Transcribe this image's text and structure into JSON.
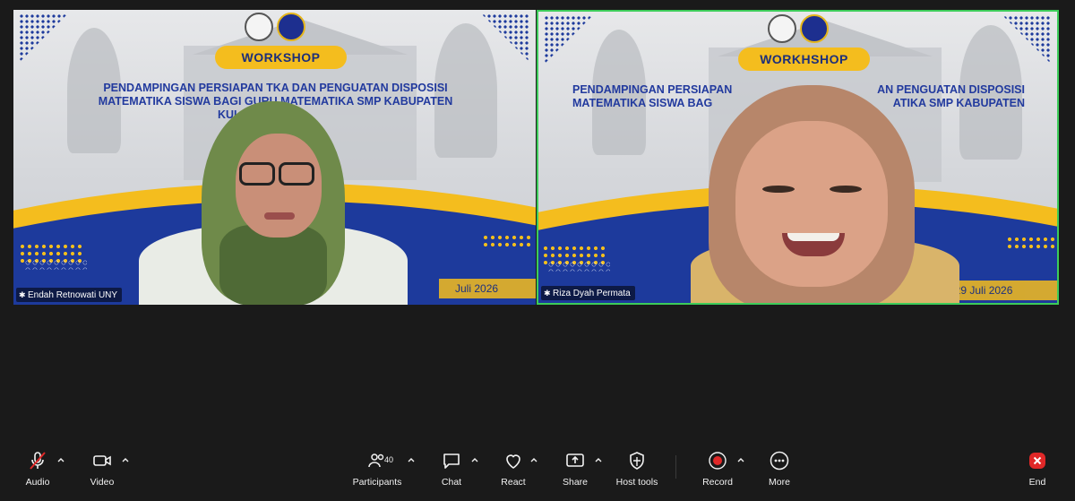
{
  "tiles": [
    {
      "participant_name": "Endah Retnowati UNY",
      "banner": {
        "badge": "WORKSHOP",
        "headline_line1": "PENDAMPINGAN PERSIAPAN TKA DAN PENGUATAN DISPOSISI",
        "headline_line2": "MATEMATIKA SISWA BAGI GURU MATEMATIKA SMP KABUPATEN",
        "headline_line3": "KULO",
        "date_text": "Juli 2026"
      },
      "active_speaker": false
    },
    {
      "participant_name": "Riza Dyah Permata",
      "banner": {
        "badge": "WORKHSHOP",
        "headline_line1": "PENDAMPINGAN PERSIAPAN",
        "headline_line1b": "AN PENGUATAN DISPOSISI",
        "headline_line2": "MATEMATIKA SISWA BAG",
        "headline_line2b": "ATIKA SMP KABUPATEN",
        "date_text": ": 29 Juli 2026"
      },
      "active_speaker": true
    }
  ],
  "toolbar": {
    "audio": {
      "label": "Audio",
      "icon": "mic-muted-icon",
      "muted_color": "#e02828"
    },
    "video": {
      "label": "Video",
      "icon": "video-camera-icon"
    },
    "participants": {
      "label": "Participants",
      "icon": "participants-icon",
      "count": "40"
    },
    "chat": {
      "label": "Chat",
      "icon": "chat-bubble-icon"
    },
    "react": {
      "label": "React",
      "icon": "heart-icon"
    },
    "share": {
      "label": "Share",
      "icon": "share-screen-icon"
    },
    "host_tools": {
      "label": "Host tools",
      "icon": "shield-icon"
    },
    "record": {
      "label": "Record",
      "icon": "record-icon",
      "color": "#e02828"
    },
    "more": {
      "label": "More",
      "icon": "more-dots-icon"
    },
    "end": {
      "label": "End",
      "icon": "end-call-icon",
      "color": "#e02828"
    }
  },
  "colors": {
    "banner_blue": "#1d3a9c",
    "banner_yellow": "#f4bd1e",
    "active_border": "#3dcc5a",
    "toolbar_bg": "#1a1a1a"
  }
}
